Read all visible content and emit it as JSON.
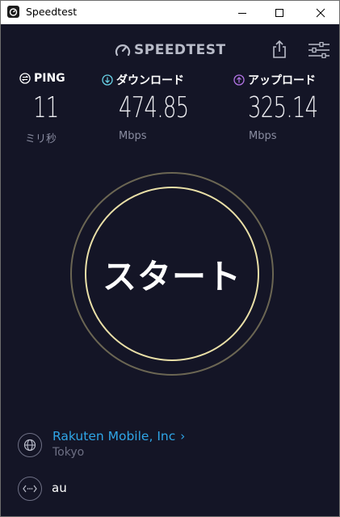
{
  "window": {
    "title": "Speedtest"
  },
  "header": {
    "logo_text": "SPEEDTEST"
  },
  "metrics": {
    "ping": {
      "label": "PING",
      "value": "11",
      "unit": "ミリ秒"
    },
    "download": {
      "label": "ダウンロード",
      "value": "474.85",
      "unit": "Mbps"
    },
    "upload": {
      "label": "アップロード",
      "value": "325.14",
      "unit": "Mbps"
    }
  },
  "start": {
    "label": "スタート"
  },
  "server": {
    "provider": "Rakuten Mobile, Inc",
    "location": "Tokyo"
  },
  "connection": {
    "name": "au"
  },
  "colors": {
    "background": "#141526",
    "accent": "#2fa5e6",
    "ring": "#e9dfa7",
    "download": "#69d2e7",
    "upload": "#b374e6"
  }
}
